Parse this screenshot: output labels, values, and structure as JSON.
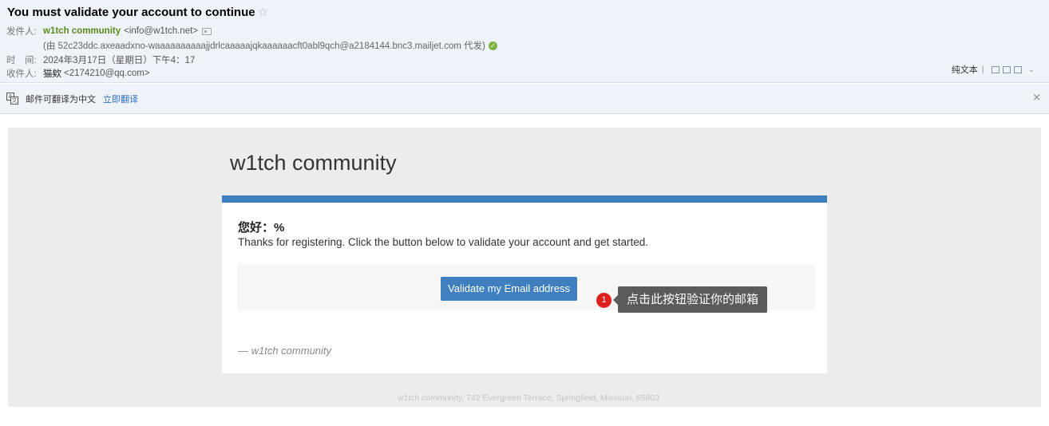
{
  "header": {
    "subject": "You must validate your account to continue",
    "star_icon": "star-outline-icon",
    "from_label": "发件人:",
    "sender_name": "w1tch community",
    "sender_email": "<info@w1tch.net>",
    "via": "(由 52c23ddc.axeaadxno-waaaaaaaaaajjdrlcaaaaajqkaaaaaacft0abl9qch@a2184144.bnc3.mailjet.com 代发)",
    "time_label": "时　间:",
    "time_value": "2024年3月17日（星期日）下午4：17",
    "to_label": "收件人:",
    "recipient_name": "猫欸",
    "recipient_email": "<2174210@qq.com>",
    "tools": {
      "plain_text": "纯文本",
      "separator": "|"
    }
  },
  "translate_bar": {
    "text": "邮件可翻译为中文",
    "link": "立即翻译",
    "close": "×"
  },
  "email": {
    "brand": "w1tch community",
    "greeting": "您好：%",
    "intro": "Thanks for registering. Click the button below to validate your account and get started.",
    "button_label": "Validate my Email address",
    "signoff": "— w1tch community",
    "footer": "w1tch community, 742 Evergreen Terrace, Springfield, Missouri, 65803"
  },
  "annotation": {
    "number": "1",
    "text": "点击此按钮验证你的邮箱"
  },
  "colors": {
    "accent_blue": "#3f7fbf",
    "sender_green": "#5a8a1b",
    "annotation_red": "#e02020",
    "tooltip_gray": "#5a5a5a"
  }
}
